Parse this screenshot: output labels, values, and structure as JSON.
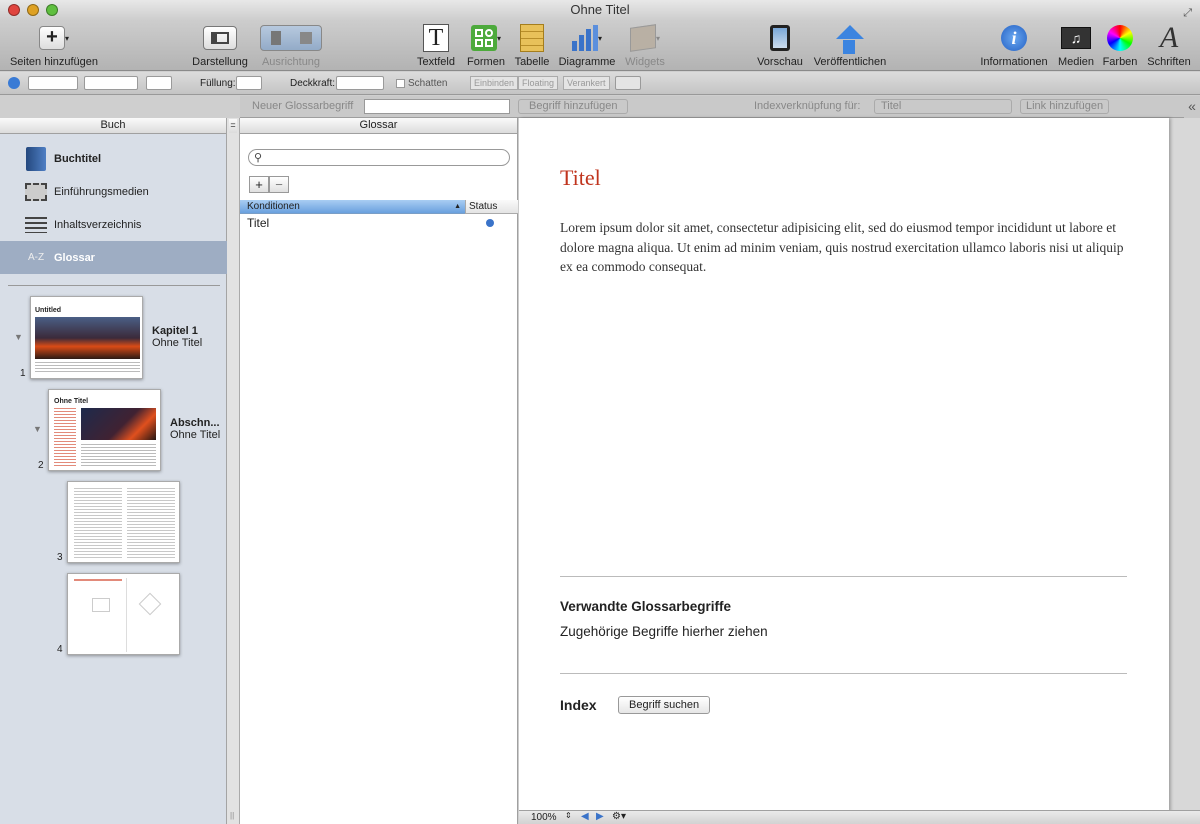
{
  "window": {
    "title": "Ohne Titel"
  },
  "toolbar": {
    "add_pages": "Seiten hinzufügen",
    "view": "Darstellung",
    "arrange": "Ausrichtung",
    "textbox": "Textfeld",
    "shapes": "Formen",
    "table": "Tabelle",
    "charts": "Diagramme",
    "widgets": "Widgets",
    "preview": "Vorschau",
    "publish": "Veröffentlichen",
    "inspector": "Informationen",
    "media": "Medien",
    "colors": "Farben",
    "fonts": "Schriften"
  },
  "format_bar": {
    "fill_label": "Füllung:",
    "opacity_label": "Deckkraft:",
    "shadow_label": "Schatten",
    "inline": "Einbinden",
    "floating": "Floating",
    "anchored": "Verankert"
  },
  "glossary_bar": {
    "new_term_placeholder": "Neuer Glossarbegriff",
    "add_term": "Begriff hinzufügen",
    "index_link_label": "Indexverknüpfung für:",
    "index_link_value": "Titel",
    "add_link": "Link hinzufügen"
  },
  "left_panel": {
    "header": "Buch",
    "items": [
      {
        "label": "Buchtitel"
      },
      {
        "label": "Einführungsmedien"
      },
      {
        "label": "Inhaltsverzeichnis"
      },
      {
        "label": "Glossar",
        "icon_text": "A-Z"
      }
    ],
    "pages": [
      {
        "num": "1",
        "title": "Kapitel 1",
        "subtitle": "Ohne Titel",
        "thumb_heading": "Untitled"
      },
      {
        "num": "2",
        "title": "Abschn...",
        "subtitle": "Ohne Titel",
        "thumb_heading": "Ohne Titel"
      },
      {
        "num": "3"
      },
      {
        "num": "4"
      }
    ]
  },
  "glossary_panel": {
    "header": "Glossar",
    "col_terms": "Konditionen",
    "col_status": "Status",
    "rows": [
      {
        "term": "Titel"
      }
    ]
  },
  "document": {
    "title": "Titel",
    "body": "Lorem ipsum dolor sit amet, consectetur adipisicing elit, sed do eiusmod tempor incididunt ut labore et dolore magna aliqua. Ut enim ad minim veniam, quis nostrud exercitation ullamco laboris nisi ut aliquip ex ea commodo consequat.",
    "related_heading": "Verwandte Glossarbegriffe",
    "related_hint": "Zugehörige Begriffe hierher ziehen",
    "index_heading": "Index",
    "find_term": "Begriff suchen"
  },
  "status_bar": {
    "zoom": "100%"
  },
  "colors": {
    "accent": "#c0341d",
    "selection": "#9eadc3",
    "header_blue": "#6aa0de"
  }
}
